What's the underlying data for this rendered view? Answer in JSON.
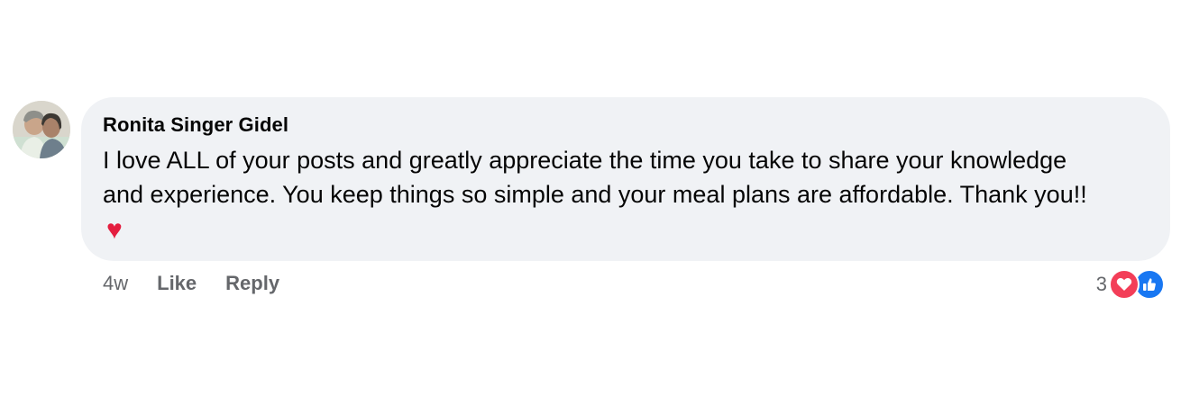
{
  "comment": {
    "author": "Ronita Singer Gidel",
    "text": "I love ALL of your posts and greatly appreciate the time you take to share your knowledge and experience. You keep things so simple and your meal plans are affordable. Thank you!!",
    "emoji": "♥",
    "emoji_name": "heart-emoji"
  },
  "actions": {
    "time": "4w",
    "like_label": "Like",
    "reply_label": "Reply"
  },
  "reactions": {
    "count": "3",
    "icons": [
      "love-reaction-icon",
      "like-reaction-icon"
    ],
    "colors": {
      "love": "#f33e58",
      "like": "#1877f2"
    }
  },
  "colors": {
    "bubble": "#f0f2f5",
    "text": "#050505",
    "secondary": "#65676b"
  }
}
